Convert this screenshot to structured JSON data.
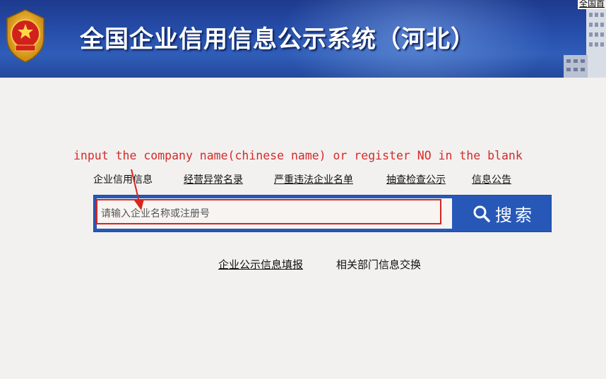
{
  "header": {
    "title": "全国企业信用信息公示系统（河北）",
    "top_link": "全国首",
    "emblem_icon": "national-emblem-icon"
  },
  "annotation": {
    "hint": "input the company name(chinese name) or register NO in the blank",
    "color": "#d32b2b"
  },
  "categories": [
    {
      "label": "企业信用信息"
    },
    {
      "label": "经营异常名录"
    },
    {
      "label": "严重违法企业名单"
    },
    {
      "label": "抽查检查公示"
    },
    {
      "label": "信息公告"
    }
  ],
  "search": {
    "placeholder": "请输入企业名称或注册号",
    "button_label": "搜索",
    "button_icon": "search-icon",
    "accent": "#2758b8"
  },
  "bottom_links": [
    {
      "label": "企业公示信息填报"
    },
    {
      "label": "相关部门信息交换"
    }
  ]
}
